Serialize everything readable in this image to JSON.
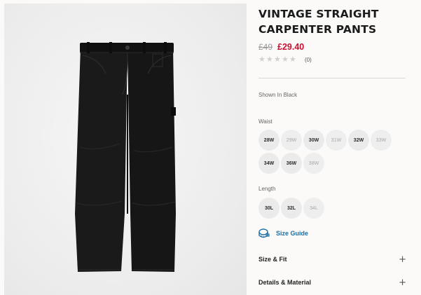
{
  "product": {
    "title": "VINTAGE STRAIGHT CARPENTER PANTS",
    "old_price": "£49",
    "sale_price": "£29.40",
    "rating_stars": 0,
    "review_count": "(0)",
    "image_alt": "Black vintage straight carpenter pants"
  },
  "colors": {
    "sale": "#c8102e",
    "link": "#1d6fa5",
    "chip_bg": "#ebebeb"
  },
  "color_label": "Shown In Black",
  "waist": {
    "label": "Waist",
    "options": [
      {
        "label": "28W",
        "available": true
      },
      {
        "label": "29W",
        "available": false
      },
      {
        "label": "30W",
        "available": true
      },
      {
        "label": "31W",
        "available": false
      },
      {
        "label": "32W",
        "available": true
      },
      {
        "label": "33W",
        "available": false
      },
      {
        "label": "34W",
        "available": true
      },
      {
        "label": "36W",
        "available": true
      },
      {
        "label": "38W",
        "available": false
      }
    ]
  },
  "length": {
    "label": "Length",
    "options": [
      {
        "label": "30L",
        "available": true
      },
      {
        "label": "32L",
        "available": true
      },
      {
        "label": "34L",
        "available": false
      }
    ]
  },
  "size_guide": {
    "label": "Size Guide",
    "icon": "ruler-tape-icon"
  },
  "accordions": [
    {
      "label": "Size & Fit",
      "icon": "plus-icon"
    },
    {
      "label": "Details & Material",
      "icon": "plus-icon"
    }
  ]
}
